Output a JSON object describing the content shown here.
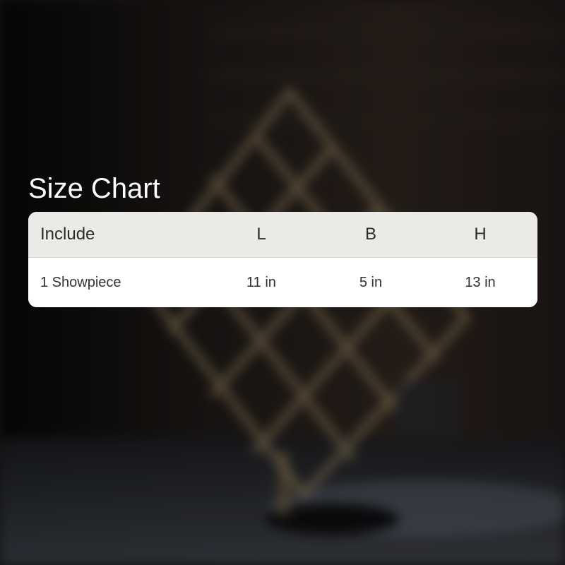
{
  "title": "Size Chart",
  "table": {
    "headers": [
      "Include",
      "L",
      "B",
      "H"
    ],
    "rows": [
      [
        "1 Showpiece",
        "11 in",
        "5 in",
        "13 in"
      ]
    ]
  },
  "colors": {
    "header_bg": "#ebeae6",
    "body_bg": "#ffffff",
    "title_text": "#ffffff"
  }
}
